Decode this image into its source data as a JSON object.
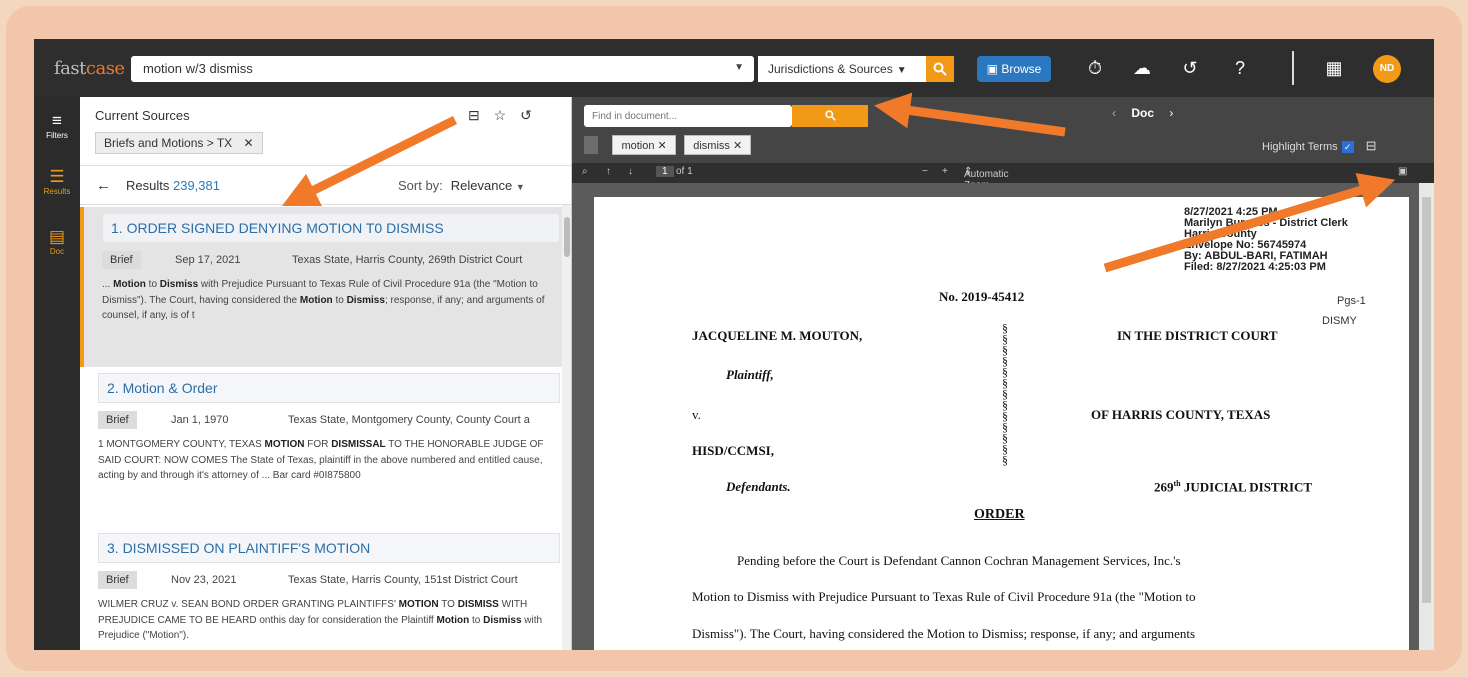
{
  "app": {
    "logo_fast": "fast",
    "logo_case": "case",
    "search_value": "motion w/3 dismiss",
    "jurisdictions_label": "Jurisdictions & Sources",
    "browse_label": "Browse",
    "avatar_initials": "ND",
    "brand_color": "#f29a17"
  },
  "rail": {
    "filters": "Filters",
    "results": "Results",
    "doc": "Doc"
  },
  "results_panel": {
    "current_sources_title": "Current Sources",
    "source_chip": "Briefs and Motions > TX",
    "results_label": "Results",
    "results_count": "239,381",
    "sort_label": "Sort by:",
    "sort_value": "Relevance"
  },
  "results": [
    {
      "title": "1. ORDER SIGNED DENYING MOTION T0 DISMISS",
      "type": "Brief",
      "date": "Sep 17, 2021",
      "court": "Texas State, Harris County, 269th District Court",
      "snippet_parts": [
        "... ",
        "Motion",
        " to ",
        "Dismiss",
        " with Prejudice Pursuant to Texas Rule of Civil Procedure 91a (the \"Motion to Dismiss\"). The Court, having considered the ",
        "Motion",
        " to ",
        "Dismiss",
        "; response, if any; and arguments of counsel, if any, is of t"
      ]
    },
    {
      "title": "2. Motion & Order",
      "type": "Brief",
      "date": "Jan 1, 1970",
      "court": "Texas State, Montgomery County, County Court a",
      "snippet_parts": [
        "1 MONTGOMERY COUNTY, TEXAS ",
        "MOTION",
        " FOR ",
        "DISMISSAL",
        " TO THE HONORABLE JUDGE OF SAID COURT: NOW COMES The State of Texas, plaintiff in the above numbered and entitled cause, acting by and through it's attorney of ... Bar card #0I875800"
      ]
    },
    {
      "title": "3. DISMISSED ON PLAINTIFF'S MOTION",
      "type": "Brief",
      "date": "Nov 23, 2021",
      "court": "Texas State, Harris County, 151st District Court",
      "snippet_parts": [
        "WILMER CRUZ v. SEAN BOND ORDER GRANTING PLAINTIFFS' ",
        "MOTION",
        " TO ",
        "DISMISS",
        " WITH PREJUDICE CAME TO BE HEARD onthis day for consideration the Plaintiff ",
        "Motion",
        " to ",
        "Dismiss",
        " with Prejudice (\"Motion\")."
      ]
    }
  ],
  "viewer": {
    "find_placeholder": "Find in document...",
    "doc_label": "Doc",
    "terms": [
      "motion",
      "dismiss"
    ],
    "highlight_label": "Highlight Terms",
    "page_input": "1",
    "page_of": "of 1",
    "zoom": "Automatic Zoom"
  },
  "document": {
    "stamp_lines": [
      "8/27/2021 4:25 PM",
      "Marilyn Burgess - District Clerk",
      "Harris County",
      "Envelope No: 56745974",
      "By: ABDUL-BARI, FATIMAH",
      "Filed: 8/27/2021 4:25:03 PM"
    ],
    "pgs": "Pgs-1",
    "dismy": "DISMY",
    "case_no": "No. 2019-45412",
    "plaintiff": "JACQUELINE M. MOUTON,",
    "plaintiff_role": "Plaintiff,",
    "versus": "v.",
    "defendant": "HISD/CCMSI,",
    "defendant_role": "Defendants.",
    "court_1": "IN THE DISTRICT COURT",
    "court_2": "OF HARRIS COUNTY, TEXAS",
    "court_3_num": "269",
    "court_3_sup": "th",
    "court_3_rest": " JUDICIAL DISTRICT",
    "section_marks": "§\n§\n§\n§\n§\n§\n§\n§\n§\n§\n§\n§\n§",
    "order_title": "ORDER",
    "body_1": "Pending before the Court is Defendant Cannon Cochran Management Services, Inc.'s",
    "body_2": "Motion to Dismiss with Prejudice Pursuant to Texas Rule of Civil Procedure 91a (the \"Motion to",
    "body_3": "Dismiss\"). The Court, having considered the Motion to Dismiss; response, if any; and arguments"
  }
}
